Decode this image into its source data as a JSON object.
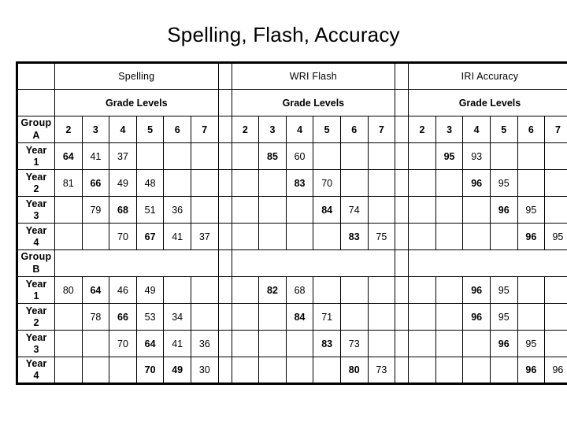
{
  "page_title": "Spelling, Flash, Accuracy",
  "colors": {
    "highlight_blue": "#4F81BD",
    "highlight_orange": "#FAC090",
    "border": "#000000",
    "background": "#FFFFFF"
  },
  "table": {
    "sections": [
      {
        "title": "Spelling",
        "subtitle": "Grade Levels",
        "grades": [
          "2",
          "3",
          "4",
          "5",
          "6",
          "7"
        ]
      },
      {
        "title": "WRI Flash",
        "subtitle": "Grade Levels",
        "grades": [
          "2",
          "3",
          "4",
          "5",
          "6",
          "7"
        ]
      },
      {
        "title": "IRI Accuracy",
        "subtitle": "Grade Levels",
        "grades": [
          "2",
          "3",
          "4",
          "5",
          "6",
          "7"
        ]
      }
    ],
    "corner_label": "Group A",
    "corner_label_line1": "Group",
    "corner_label_line2": "A",
    "group_b_label_line1": "Group",
    "group_b_label_line2": "B",
    "groups": [
      {
        "name": "Group A",
        "rows": [
          {
            "label_line1": "Year",
            "label_line2": "1",
            "spelling": [
              {
                "value": "64",
                "style": "blue"
              },
              {
                "value": "41",
                "style": "orange"
              },
              {
                "value": "37",
                "style": "plain"
              },
              {
                "value": "",
                "style": "empty"
              },
              {
                "value": "",
                "style": "empty"
              },
              {
                "value": "",
                "style": "empty"
              }
            ],
            "wri": [
              {
                "value": "",
                "style": "empty"
              },
              {
                "value": "85",
                "style": "blue"
              },
              {
                "value": "60",
                "style": "orange"
              },
              {
                "value": "",
                "style": "empty"
              },
              {
                "value": "",
                "style": "empty"
              },
              {
                "value": "",
                "style": "empty"
              }
            ],
            "iri": [
              {
                "value": "",
                "style": "empty"
              },
              {
                "value": "95",
                "style": "blue"
              },
              {
                "value": "93",
                "style": "orange"
              },
              {
                "value": "",
                "style": "empty"
              },
              {
                "value": "",
                "style": "empty"
              },
              {
                "value": "",
                "style": "empty"
              }
            ]
          },
          {
            "label_line1": "Year",
            "label_line2": "2",
            "spelling": [
              {
                "value": "81",
                "style": "plain"
              },
              {
                "value": "66",
                "style": "blue"
              },
              {
                "value": "49",
                "style": "orange"
              },
              {
                "value": "48",
                "style": "plain"
              },
              {
                "value": "",
                "style": "empty"
              },
              {
                "value": "",
                "style": "empty"
              }
            ],
            "wri": [
              {
                "value": "",
                "style": "empty"
              },
              {
                "value": "",
                "style": "empty"
              },
              {
                "value": "83",
                "style": "blue"
              },
              {
                "value": "70",
                "style": "orange"
              },
              {
                "value": "",
                "style": "empty"
              },
              {
                "value": "",
                "style": "empty"
              }
            ],
            "iri": [
              {
                "value": "",
                "style": "empty"
              },
              {
                "value": "",
                "style": "empty"
              },
              {
                "value": "96",
                "style": "blue"
              },
              {
                "value": "95",
                "style": "orange"
              },
              {
                "value": "",
                "style": "empty"
              },
              {
                "value": "",
                "style": "empty"
              }
            ]
          },
          {
            "label_line1": "Year",
            "label_line2": "3",
            "spelling": [
              {
                "value": "",
                "style": "empty"
              },
              {
                "value": "79",
                "style": "plain"
              },
              {
                "value": "68",
                "style": "blue"
              },
              {
                "value": "51",
                "style": "orange"
              },
              {
                "value": "36",
                "style": "plain"
              },
              {
                "value": "",
                "style": "empty"
              }
            ],
            "wri": [
              {
                "value": "",
                "style": "empty"
              },
              {
                "value": "",
                "style": "empty"
              },
              {
                "value": "",
                "style": "empty"
              },
              {
                "value": "84",
                "style": "blue"
              },
              {
                "value": "74",
                "style": "orange"
              },
              {
                "value": "",
                "style": "empty"
              }
            ],
            "iri": [
              {
                "value": "",
                "style": "empty"
              },
              {
                "value": "",
                "style": "empty"
              },
              {
                "value": "",
                "style": "empty"
              },
              {
                "value": "96",
                "style": "blue"
              },
              {
                "value": "95",
                "style": "orange"
              },
              {
                "value": "",
                "style": "empty"
              }
            ]
          },
          {
            "label_line1": "Year",
            "label_line2": "4",
            "spelling": [
              {
                "value": "",
                "style": "empty"
              },
              {
                "value": "",
                "style": "empty"
              },
              {
                "value": "70",
                "style": "plain"
              },
              {
                "value": "67",
                "style": "blue"
              },
              {
                "value": "41",
                "style": "orange"
              },
              {
                "value": "37",
                "style": "plain"
              }
            ],
            "wri": [
              {
                "value": "",
                "style": "empty"
              },
              {
                "value": "",
                "style": "empty"
              },
              {
                "value": "",
                "style": "empty"
              },
              {
                "value": "",
                "style": "empty"
              },
              {
                "value": "83",
                "style": "blue"
              },
              {
                "value": "75",
                "style": "orange"
              }
            ],
            "iri": [
              {
                "value": "",
                "style": "empty"
              },
              {
                "value": "",
                "style": "empty"
              },
              {
                "value": "",
                "style": "empty"
              },
              {
                "value": "",
                "style": "empty"
              },
              {
                "value": "96",
                "style": "blue"
              },
              {
                "value": "95",
                "style": "orange"
              }
            ]
          }
        ]
      },
      {
        "name": "Group B",
        "rows": [
          {
            "label_line1": "Year",
            "label_line2": "1",
            "spelling": [
              {
                "value": "80",
                "style": "plain"
              },
              {
                "value": "64",
                "style": "blue"
              },
              {
                "value": "46",
                "style": "orange"
              },
              {
                "value": "49",
                "style": "plain"
              },
              {
                "value": "",
                "style": "empty"
              },
              {
                "value": "",
                "style": "empty"
              }
            ],
            "wri": [
              {
                "value": "",
                "style": "empty"
              },
              {
                "value": "82",
                "style": "blue"
              },
              {
                "value": "68",
                "style": "orange"
              },
              {
                "value": "",
                "style": "empty"
              },
              {
                "value": "",
                "style": "empty"
              },
              {
                "value": "",
                "style": "empty"
              }
            ],
            "iri": [
              {
                "value": "",
                "style": "empty"
              },
              {
                "value": "",
                "style": "empty"
              },
              {
                "value": "96",
                "style": "blue"
              },
              {
                "value": "95",
                "style": "orange"
              },
              {
                "value": "",
                "style": "empty"
              },
              {
                "value": "",
                "style": "empty"
              }
            ]
          },
          {
            "label_line1": "Year",
            "label_line2": "2",
            "spelling": [
              {
                "value": "",
                "style": "empty"
              },
              {
                "value": "78",
                "style": "plain"
              },
              {
                "value": "66",
                "style": "blue"
              },
              {
                "value": "53",
                "style": "orange"
              },
              {
                "value": "34",
                "style": "plain"
              },
              {
                "value": "",
                "style": "empty"
              }
            ],
            "wri": [
              {
                "value": "",
                "style": "empty"
              },
              {
                "value": "",
                "style": "empty"
              },
              {
                "value": "84",
                "style": "blue"
              },
              {
                "value": "71",
                "style": "orange"
              },
              {
                "value": "",
                "style": "empty"
              },
              {
                "value": "",
                "style": "empty"
              }
            ],
            "iri": [
              {
                "value": "",
                "style": "empty"
              },
              {
                "value": "",
                "style": "empty"
              },
              {
                "value": "96",
                "style": "blue"
              },
              {
                "value": "95",
                "style": "orange"
              },
              {
                "value": "",
                "style": "empty"
              },
              {
                "value": "",
                "style": "empty"
              }
            ]
          },
          {
            "label_line1": "Year",
            "label_line2": "3",
            "spelling": [
              {
                "value": "",
                "style": "empty"
              },
              {
                "value": "",
                "style": "empty"
              },
              {
                "value": "70",
                "style": "plain"
              },
              {
                "value": "64",
                "style": "blue"
              },
              {
                "value": "41",
                "style": "orange"
              },
              {
                "value": "36",
                "style": "plain"
              }
            ],
            "wri": [
              {
                "value": "",
                "style": "empty"
              },
              {
                "value": "",
                "style": "empty"
              },
              {
                "value": "",
                "style": "empty"
              },
              {
                "value": "83",
                "style": "blue"
              },
              {
                "value": "73",
                "style": "orange"
              },
              {
                "value": "",
                "style": "empty"
              }
            ],
            "iri": [
              {
                "value": "",
                "style": "empty"
              },
              {
                "value": "",
                "style": "empty"
              },
              {
                "value": "",
                "style": "empty"
              },
              {
                "value": "96",
                "style": "blue"
              },
              {
                "value": "95",
                "style": "orange"
              },
              {
                "value": "",
                "style": "empty"
              }
            ]
          },
          {
            "label_line1": "Year",
            "label_line2": "4",
            "spelling": [
              {
                "value": "",
                "style": "empty"
              },
              {
                "value": "",
                "style": "empty"
              },
              {
                "value": "",
                "style": "empty"
              },
              {
                "value": "70",
                "style": "bold"
              },
              {
                "value": "49",
                "style": "blue"
              },
              {
                "value": "30",
                "style": "orange"
              }
            ],
            "wri": [
              {
                "value": "",
                "style": "empty"
              },
              {
                "value": "",
                "style": "empty"
              },
              {
                "value": "",
                "style": "empty"
              },
              {
                "value": "",
                "style": "empty"
              },
              {
                "value": "80",
                "style": "blue"
              },
              {
                "value": "73",
                "style": "orange"
              }
            ],
            "iri": [
              {
                "value": "",
                "style": "empty"
              },
              {
                "value": "",
                "style": "empty"
              },
              {
                "value": "",
                "style": "empty"
              },
              {
                "value": "",
                "style": "empty"
              },
              {
                "value": "96",
                "style": "blue"
              },
              {
                "value": "96",
                "style": "orange"
              }
            ]
          }
        ]
      }
    ]
  }
}
